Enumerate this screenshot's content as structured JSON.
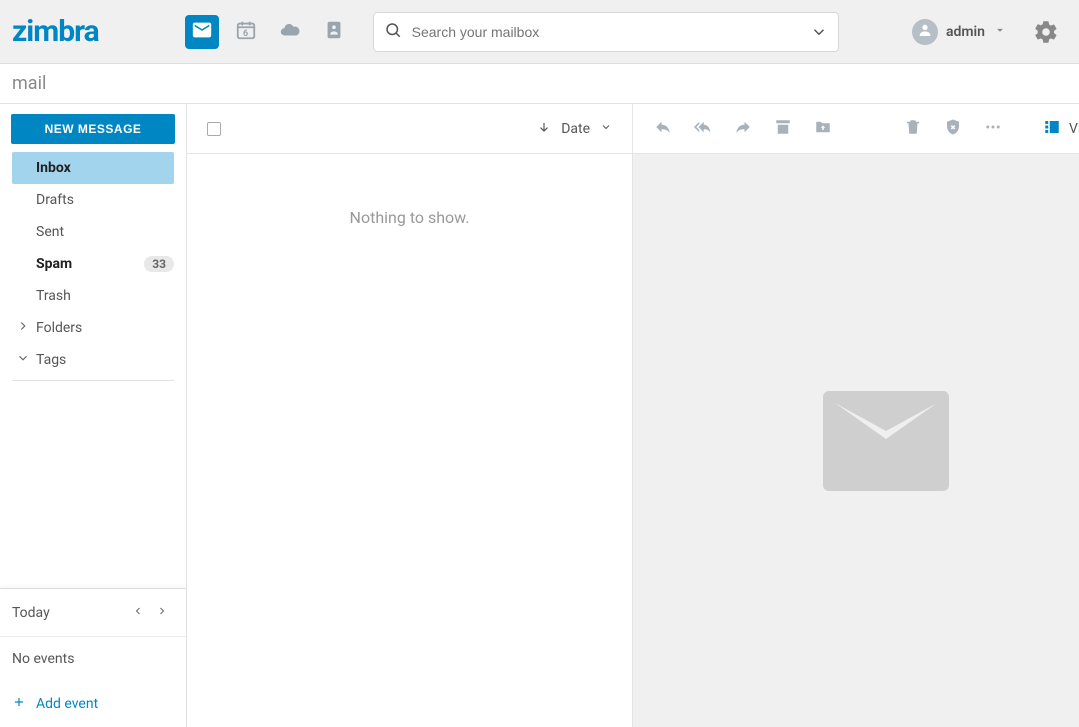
{
  "brand": "zimbra",
  "apps": {
    "calendar_date": "6"
  },
  "search": {
    "placeholder": "Search your mailbox"
  },
  "user": {
    "name": "admin"
  },
  "crumb": "mail",
  "sidebar": {
    "new_message": "NEW MESSAGE",
    "folders": [
      {
        "name": "Inbox",
        "active": true,
        "bold": true,
        "count": null
      },
      {
        "name": "Drafts",
        "active": false,
        "bold": false,
        "count": null
      },
      {
        "name": "Sent",
        "active": false,
        "bold": false,
        "count": null
      },
      {
        "name": "Spam",
        "active": false,
        "bold": true,
        "count": "33"
      },
      {
        "name": "Trash",
        "active": false,
        "bold": false,
        "count": null
      }
    ],
    "groups": {
      "folders": "Folders",
      "tags": "Tags"
    },
    "calendar": {
      "today": "Today",
      "no_events": "No events",
      "add_event": "Add event"
    }
  },
  "list": {
    "sort_label": "Date",
    "empty": "Nothing to show."
  },
  "reader": {
    "view_label": "View"
  }
}
